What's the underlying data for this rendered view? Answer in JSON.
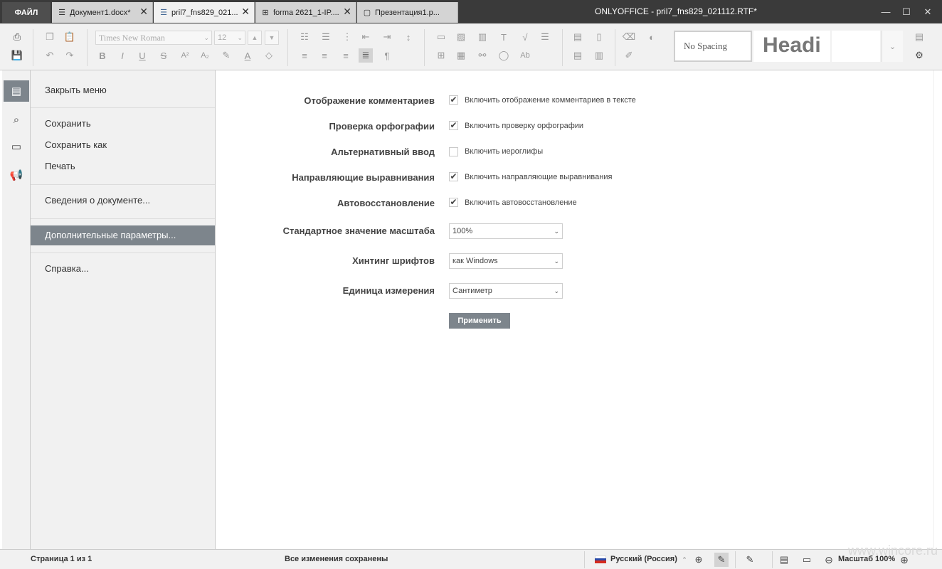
{
  "titlebar": {
    "file_tab": "ФАЙЛ",
    "tabs": [
      {
        "label": "Документ1.docx*",
        "icon": "document-icon",
        "glyph": "☰"
      },
      {
        "label": "pril7_fns829_021...",
        "icon": "document-icon",
        "glyph": "☰"
      },
      {
        "label": "forma 2621_1-IP....",
        "icon": "spreadsheet-icon",
        "glyph": "⊞"
      },
      {
        "label": "Презентация1.p...",
        "icon": "presentation-icon",
        "glyph": "▢"
      }
    ],
    "window_title": "ONLYOFFICE - pril7_fns829_021112.RTF*"
  },
  "toolbar": {
    "font_name": "Times New Roman",
    "font_size": "12",
    "style_no_spacing": "No Spacing",
    "style_heading": "Headi"
  },
  "file_menu": {
    "close_menu": "Закрыть меню",
    "save": "Сохранить",
    "save_as": "Сохранить как",
    "print": "Печать",
    "doc_info": "Сведения о документе...",
    "advanced": "Дополнительные параметры...",
    "help": "Справка..."
  },
  "settings": {
    "comments": {
      "label": "Отображение комментариев",
      "option": "Включить отображение комментариев в тексте",
      "checked": true
    },
    "spell": {
      "label": "Проверка орфографии",
      "option": "Включить проверку орфографии",
      "checked": true
    },
    "alt_input": {
      "label": "Альтернативный ввод",
      "option": "Включить иероглифы",
      "checked": false
    },
    "guides": {
      "label": "Направляющие выравнивания",
      "option": "Включить направляющие выравнивания",
      "checked": true
    },
    "autorecover": {
      "label": "Автовосстановление",
      "option": "Включить автовосстановление",
      "checked": true
    },
    "zoom": {
      "label": "Стандартное значение масштаба",
      "value": "100%"
    },
    "hinting": {
      "label": "Хинтинг шрифтов",
      "value": "как Windows"
    },
    "unit": {
      "label": "Единица измерения",
      "value": "Сантиметр"
    },
    "apply": "Применить"
  },
  "statusbar": {
    "page": "Страница 1 из 1",
    "saved": "Все изменения сохранены",
    "language": "Русский (Россия)",
    "zoom": "Масштаб 100%"
  },
  "watermark": "www.wincore.ru",
  "colors": {
    "accent": "#7d858c",
    "titlebar": "#3a3a3a",
    "toolbar": "#f1f1f1"
  }
}
